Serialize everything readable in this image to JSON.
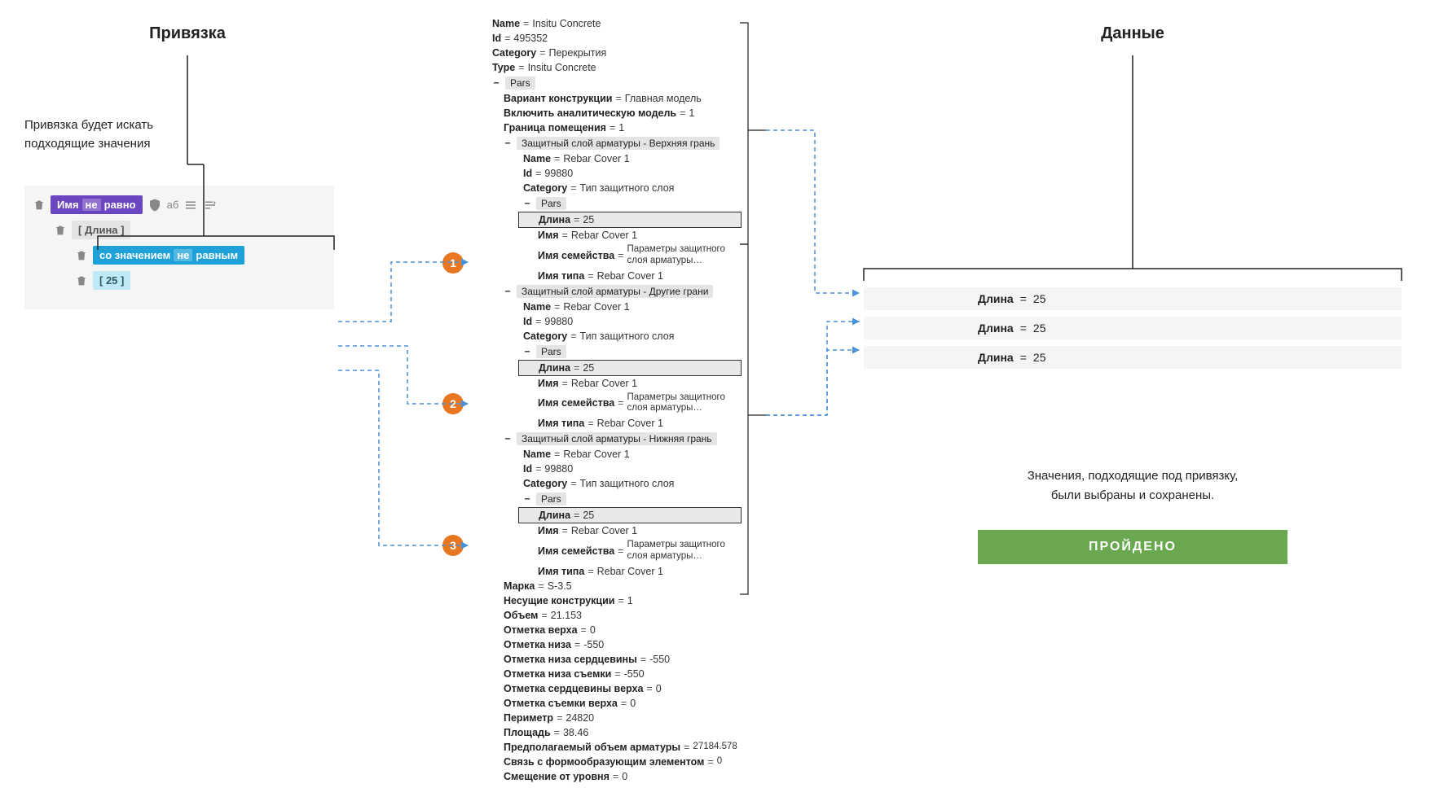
{
  "left": {
    "heading": "Привязка",
    "subtext_line1": "Привязка будет искать",
    "subtext_line2": "подходящие  значения",
    "rule": {
      "name_prefix": "Имя",
      "name_ne": "не",
      "name_suffix": "равно",
      "ab": "аб",
      "param": "[ Длина ]",
      "value_prefix": "со значением",
      "value_ne": "не",
      "value_suffix": "равным",
      "constant": "[ 25 ]"
    }
  },
  "mid": {
    "root": [
      {
        "k": "Name",
        "v": "Insitu Concrete"
      },
      {
        "k": "Id",
        "v": "495352"
      },
      {
        "k": "Category",
        "v": "Перекрытия"
      },
      {
        "k": "Type",
        "v": "Insitu Concrete"
      }
    ],
    "pars_label": "Pars",
    "pars_top": [
      {
        "k": "Вариант конструкции",
        "v": "Главная модель"
      },
      {
        "k": "Включить аналитическую модель",
        "v": "1"
      },
      {
        "k": "Граница помещения",
        "v": "1"
      }
    ],
    "sections": [
      {
        "title": "Защитный слой арматуры - Верхняя грань",
        "head": [
          {
            "k": "Name",
            "v": "Rebar Cover 1"
          },
          {
            "k": "Id",
            "v": "99880"
          },
          {
            "k": "Category",
            "v": "Тип защитного слоя"
          }
        ],
        "highlight": {
          "k": "Длина",
          "v": "25"
        },
        "tail": [
          {
            "k": "Имя",
            "v": "Rebar Cover 1"
          },
          {
            "k": "Имя семейства",
            "v": "Параметры защитного слоя арматуры…",
            "multi": true
          },
          {
            "k": "Имя типа",
            "v": "Rebar Cover 1"
          }
        ]
      },
      {
        "title": "Защитный слой арматуры - Другие грани",
        "head": [
          {
            "k": "Name",
            "v": "Rebar Cover 1"
          },
          {
            "k": "Id",
            "v": "99880"
          },
          {
            "k": "Category",
            "v": "Тип защитного слоя"
          }
        ],
        "highlight": {
          "k": "Длина",
          "v": "25"
        },
        "tail": [
          {
            "k": "Имя",
            "v": "Rebar Cover 1"
          },
          {
            "k": "Имя семейства",
            "v": "Параметры защитного слоя арматуры…",
            "multi": true
          },
          {
            "k": "Имя типа",
            "v": "Rebar Cover 1"
          }
        ]
      },
      {
        "title": "Защитный слой арматуры - Нижняя грань",
        "head": [
          {
            "k": "Name",
            "v": "Rebar Cover 1"
          },
          {
            "k": "Id",
            "v": "99880"
          },
          {
            "k": "Category",
            "v": "Тип защитного слоя"
          }
        ],
        "highlight": {
          "k": "Длина",
          "v": "25"
        },
        "tail": [
          {
            "k": "Имя",
            "v": "Rebar Cover 1"
          },
          {
            "k": "Имя семейства",
            "v": "Параметры защитного слоя арматуры…",
            "multi": true
          },
          {
            "k": "Имя типа",
            "v": "Rebar Cover 1"
          }
        ]
      }
    ],
    "pars_bottom": [
      {
        "k": "Марка",
        "v": "S-3.5"
      },
      {
        "k": "Несущие конструкции",
        "v": "1"
      },
      {
        "k": "Объем",
        "v": "21.153"
      },
      {
        "k": "Отметка верха",
        "v": "0"
      },
      {
        "k": "Отметка низа",
        "v": "-550"
      },
      {
        "k": "Отметка низа сердцевины",
        "v": "-550"
      },
      {
        "k": "Отметка низа съемки",
        "v": "-550"
      },
      {
        "k": "Отметка сердцевины верха",
        "v": "0"
      },
      {
        "k": "Отметка съемки верха",
        "v": "0"
      },
      {
        "k": "Периметр",
        "v": "24820"
      },
      {
        "k": "Площадь",
        "v": "38.46"
      },
      {
        "k": "Предполагаемый объем арматуры",
        "v": "27184.578",
        "multi": true
      },
      {
        "k": "Связь с формообразующим элементом",
        "v": "0",
        "multi": true
      },
      {
        "k": "Смещение от уровня",
        "v": "0"
      }
    ]
  },
  "right": {
    "heading": "Данные",
    "rows": [
      {
        "k": "Длина",
        "v": "25"
      },
      {
        "k": "Длина",
        "v": "25"
      },
      {
        "k": "Длина",
        "v": "25"
      }
    ],
    "subtext_line1": "Значения, подходящие под привязку,",
    "subtext_line2": "были выбраны и сохранены.",
    "status": "ПРОЙДЕНО"
  },
  "markers": [
    "1",
    "2",
    "3"
  ]
}
